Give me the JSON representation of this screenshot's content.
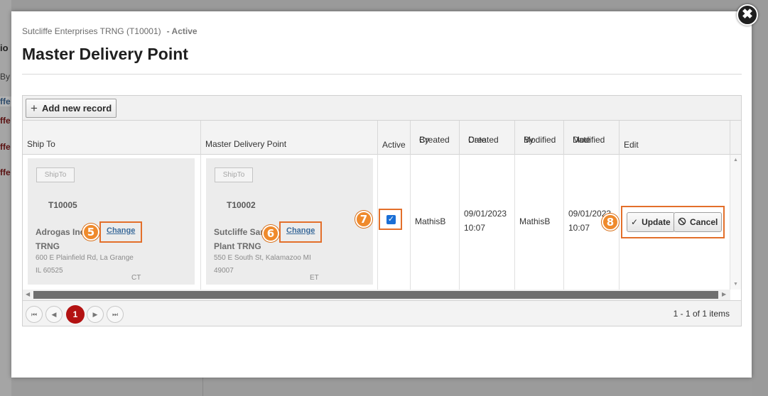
{
  "background": {
    "fragments": [
      "io",
      "By",
      "ffe",
      "ffe",
      "ffe",
      "ffe"
    ]
  },
  "modal": {
    "close_glyph": "✖",
    "subtitle": "Sutcliffe Enterprises TRNG (T10001)",
    "status": "- Active",
    "title": "Master Delivery Point"
  },
  "toolbar": {
    "add_label": "Add new record"
  },
  "columns": {
    "ship_to": "Ship To",
    "mdp": "Master Delivery Point",
    "active": "Active",
    "created_by": [
      "Created",
      "By"
    ],
    "created_date": [
      "Created",
      "Date"
    ],
    "modified_by": [
      "Modified",
      "By"
    ],
    "modified_date": [
      "Modified",
      "Date"
    ],
    "edit": "Edit"
  },
  "row": {
    "ship_to": {
      "tag": "ShipTo",
      "code": "T10005",
      "name_line1": "Adrogas Inc",
      "name_line2": "TRNG",
      "address1": "600 E Plainfield Rd, La Grange",
      "address2": "IL 60525",
      "timezone": "CT",
      "change_label": "Change"
    },
    "mdp": {
      "tag": "ShipTo",
      "code": "T10002",
      "name_line1": "Sutcliffe San",
      "name_line2": "Plant TRNG",
      "address1": "550 E South St, Kalamazoo MI",
      "address2": "49007",
      "timezone": "ET",
      "change_label": "Change"
    },
    "active_checked": true,
    "created_by": "MathisB",
    "created_date": [
      "09/01/2023",
      "10:07"
    ],
    "modified_by": "MathisB",
    "modified_date": [
      "09/01/2023",
      "10:07"
    ],
    "update_label": "Update",
    "cancel_label": "Cancel"
  },
  "callouts": [
    "5",
    "6",
    "7",
    "8"
  ],
  "pager": {
    "current_page": "1",
    "info": "1 - 1 of 1 items"
  },
  "colors": {
    "accent_orange": "#e36f2a",
    "badge_orange": "#ef8a2c",
    "page_active": "#b31212",
    "link_blue": "#3a6a9a",
    "checkbox_blue": "#1a6fd6"
  }
}
